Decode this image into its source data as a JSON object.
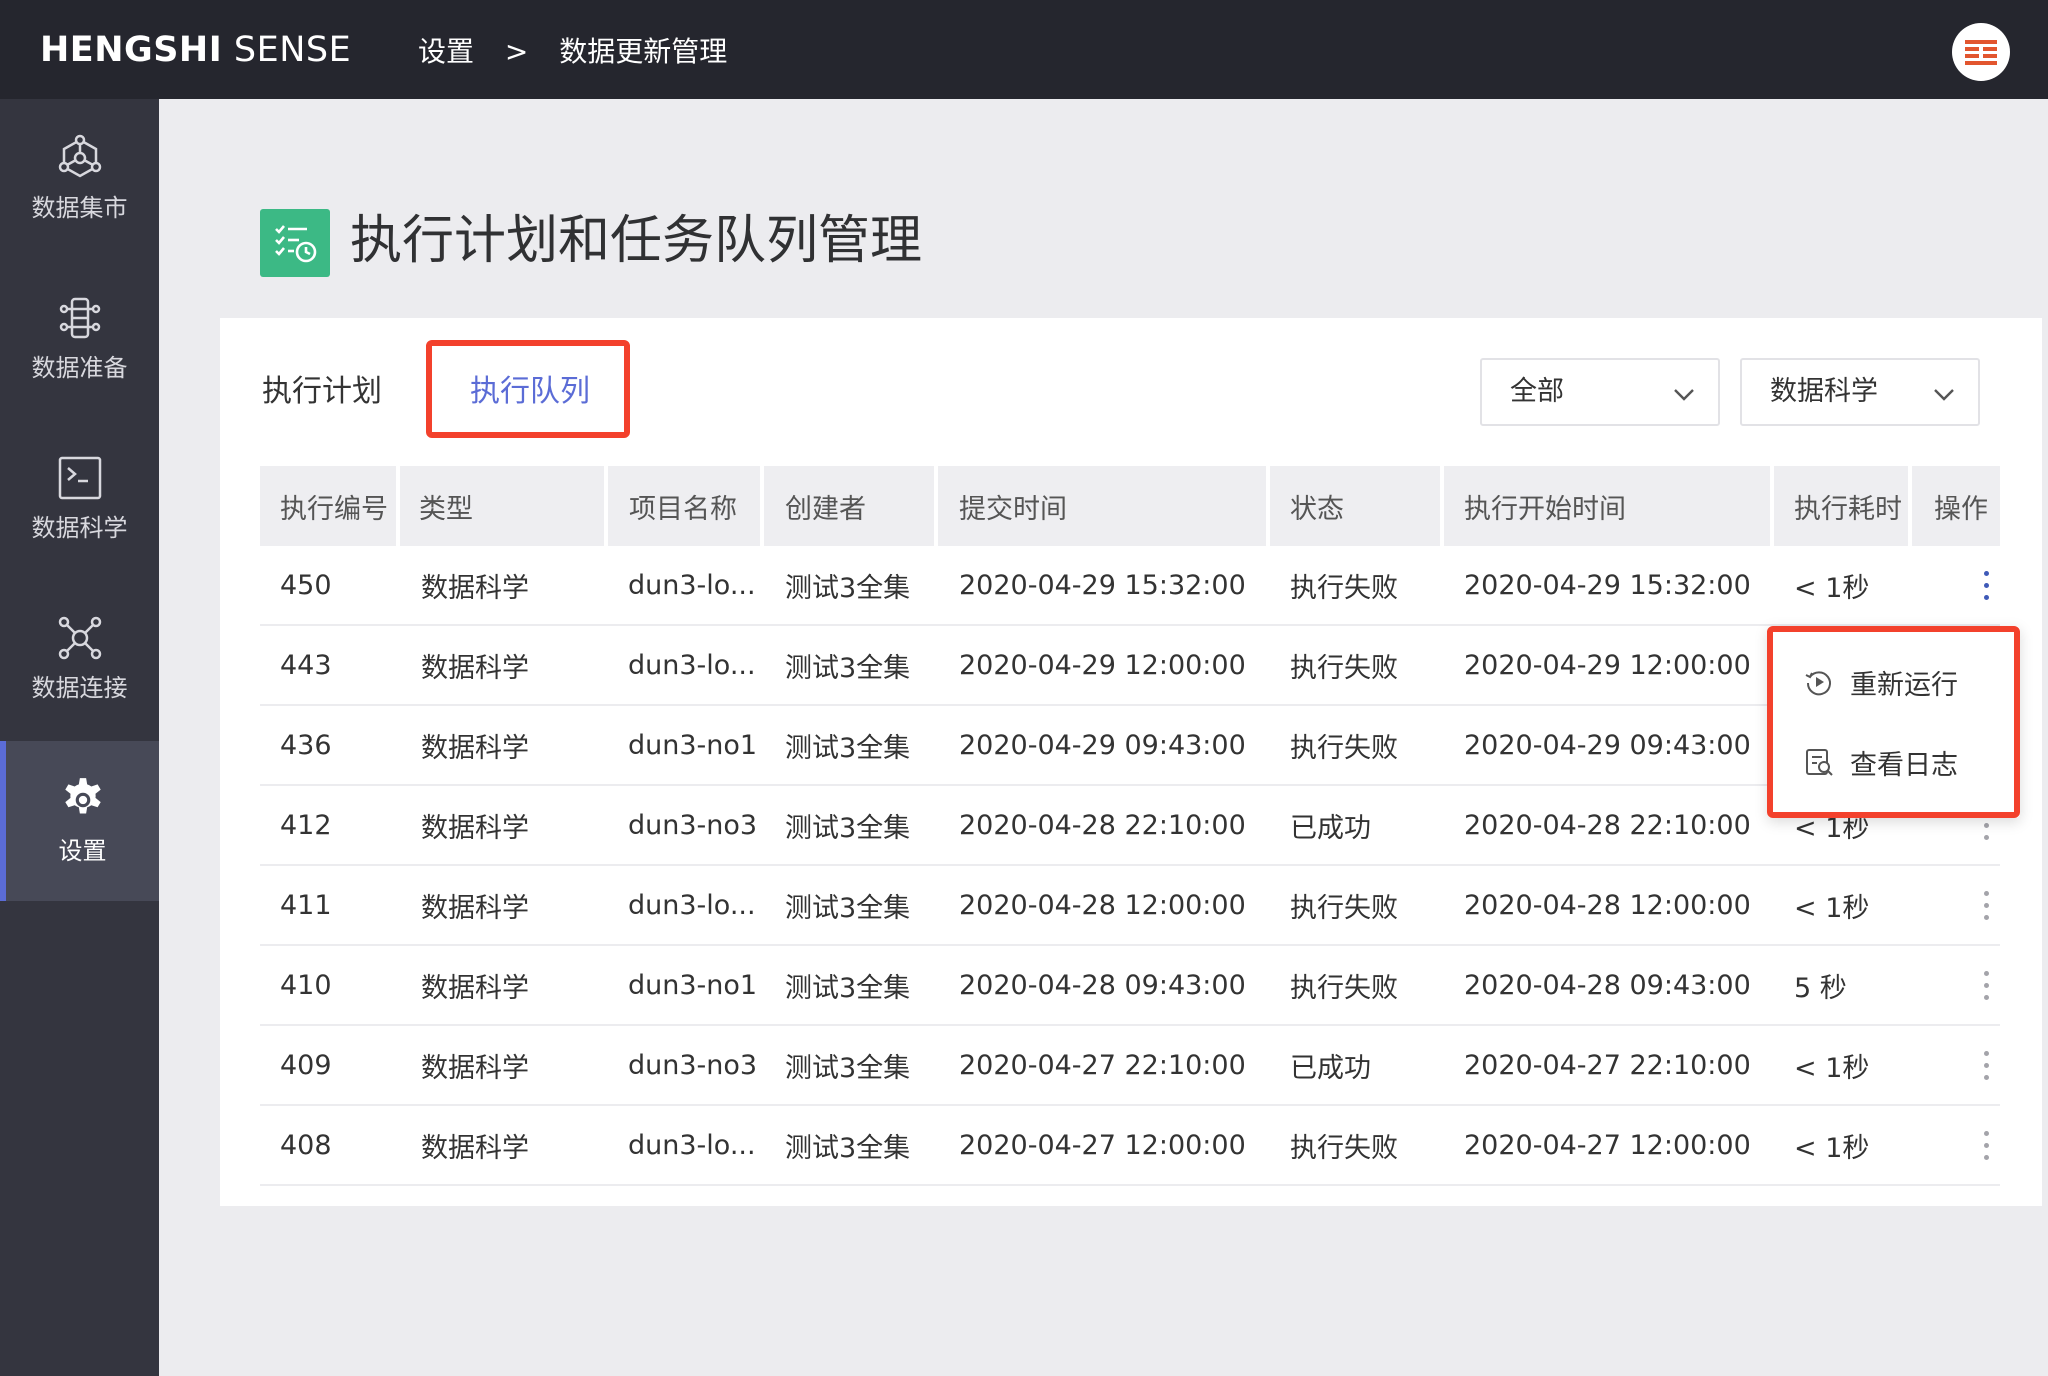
{
  "topbar": {
    "brand_bold": "HENGSHI",
    "brand_rest": " SENSE",
    "breadcrumb": [
      "设置",
      ">",
      "数据更新管理"
    ]
  },
  "sidebar": {
    "items": [
      {
        "label": "数据集市",
        "icon": "data-mart-icon"
      },
      {
        "label": "数据准备",
        "icon": "data-prep-icon"
      },
      {
        "label": "数据科学",
        "icon": "data-science-icon"
      },
      {
        "label": "数据连接",
        "icon": "data-connection-icon"
      },
      {
        "label": "设置",
        "icon": "settings-gear-icon",
        "active": true
      }
    ]
  },
  "page": {
    "title": "执行计划和任务队列管理"
  },
  "tabs": [
    {
      "label": "执行计划"
    },
    {
      "label": "执行队列",
      "active": true
    }
  ],
  "filters": {
    "status": "全部",
    "type": "数据科学"
  },
  "table": {
    "columns": [
      "执行编号",
      "类型",
      "项目名称",
      "创建者",
      "提交时间",
      "状态",
      "执行开始时间",
      "执行耗时",
      "操作"
    ],
    "rows": [
      [
        "450",
        "数据科学",
        "dun3-lo...",
        "测试3全集",
        "2020-04-29 15:32:00",
        "执行失败",
        "2020-04-29 15:32:00",
        "< 1秒"
      ],
      [
        "443",
        "数据科学",
        "dun3-lo...",
        "测试3全集",
        "2020-04-29 12:00:00",
        "执行失败",
        "2020-04-29 12:00:00",
        ""
      ],
      [
        "436",
        "数据科学",
        "dun3-no1",
        "测试3全集",
        "2020-04-29 09:43:00",
        "执行失败",
        "2020-04-29 09:43:00",
        ""
      ],
      [
        "412",
        "数据科学",
        "dun3-no3",
        "测试3全集",
        "2020-04-28 22:10:00",
        "已成功",
        "2020-04-28 22:10:00",
        "< 1秒"
      ],
      [
        "411",
        "数据科学",
        "dun3-lo...",
        "测试3全集",
        "2020-04-28 12:00:00",
        "执行失败",
        "2020-04-28 12:00:00",
        "< 1秒"
      ],
      [
        "410",
        "数据科学",
        "dun3-no1",
        "测试3全集",
        "2020-04-28 09:43:00",
        "执行失败",
        "2020-04-28 09:43:00",
        "5 秒"
      ],
      [
        "409",
        "数据科学",
        "dun3-no3",
        "测试3全集",
        "2020-04-27 22:10:00",
        "已成功",
        "2020-04-27 22:10:00",
        "< 1秒"
      ],
      [
        "408",
        "数据科学",
        "dun3-lo...",
        "测试3全集",
        "2020-04-27 12:00:00",
        "执行失败",
        "2020-04-27 12:00:00",
        "< 1秒"
      ]
    ]
  },
  "action_menu": {
    "items": [
      {
        "label": "重新运行",
        "icon": "rerun-icon"
      },
      {
        "label": "查看日志",
        "icon": "view-log-icon"
      }
    ]
  },
  "colors": {
    "accent": "#5b6cd6",
    "highlight": "#f3412c",
    "page_icon": "#3cb985",
    "topbar": "#25262e",
    "sidebar": "#34353f"
  }
}
